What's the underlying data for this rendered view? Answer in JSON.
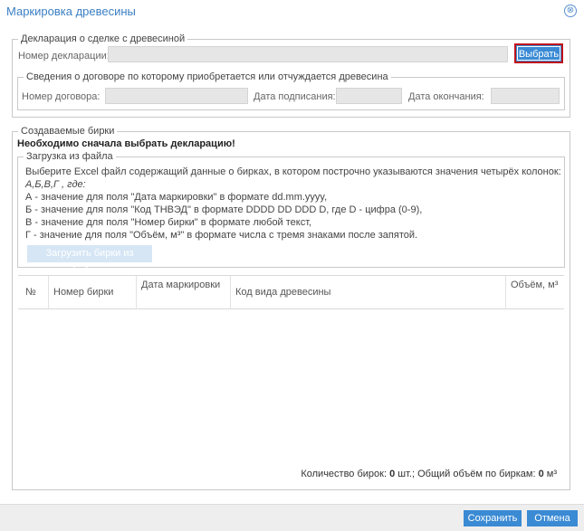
{
  "window": {
    "title": "Маркировка древесины",
    "close_symbol": "⊗"
  },
  "declaration": {
    "legend": "Декларация о сделке с древесиной",
    "number_label": "Номер декларации:",
    "number_value": "",
    "select_button": "Выбрать",
    "contract": {
      "legend": "Сведения о договоре по которому приобретается или отчуждается древесина",
      "contract_number_label": "Номер договора:",
      "contract_number_value": "",
      "sign_date_label": "Дата подписания:",
      "sign_date_value": "",
      "end_date_label": "Дата окончания:",
      "end_date_value": ""
    }
  },
  "tags": {
    "legend": "Создаваемые бирки",
    "warning": "Необходимо сначала выбрать декларацию!",
    "upload": {
      "legend": "Загрузка из файла",
      "lines": [
        "Выберите Excel файл содержащий данные о бирках, в котором построчно указываются значения четырёх колонок:",
        "А,Б,В,Г , где:",
        "А - значение для поля \"Дата маркировки\" в формате dd.mm.yyyy,",
        "Б - значение для поля \"Код ТНВЭД\" в формате DDDD DD DDD D, где D - цифра (0-9),",
        "В - значение для поля \"Номер бирки\" в формате любой текст,",
        "Г - значение для поля \"Объём, м³\" в формате числа с тремя знаками после запятой."
      ],
      "button": "Загрузить бирки из файла..."
    },
    "table": {
      "columns": [
        "№",
        "Номер бирки",
        "Дата маркировки",
        "Код вида древесины",
        "Объём, м³"
      ],
      "rows": []
    },
    "summary": {
      "count_label": "Количество бирок:",
      "count_value": "0",
      "count_unit": "шт.;",
      "volume_label": "Общий объём по биркам:",
      "volume_value": "0",
      "volume_unit": "м³"
    }
  },
  "footer": {
    "save": "Сохранить",
    "cancel": "Отмена"
  },
  "colors": {
    "accent": "#3a8ad4",
    "title": "#3b7fc4",
    "highlight_border": "#c0141a"
  }
}
